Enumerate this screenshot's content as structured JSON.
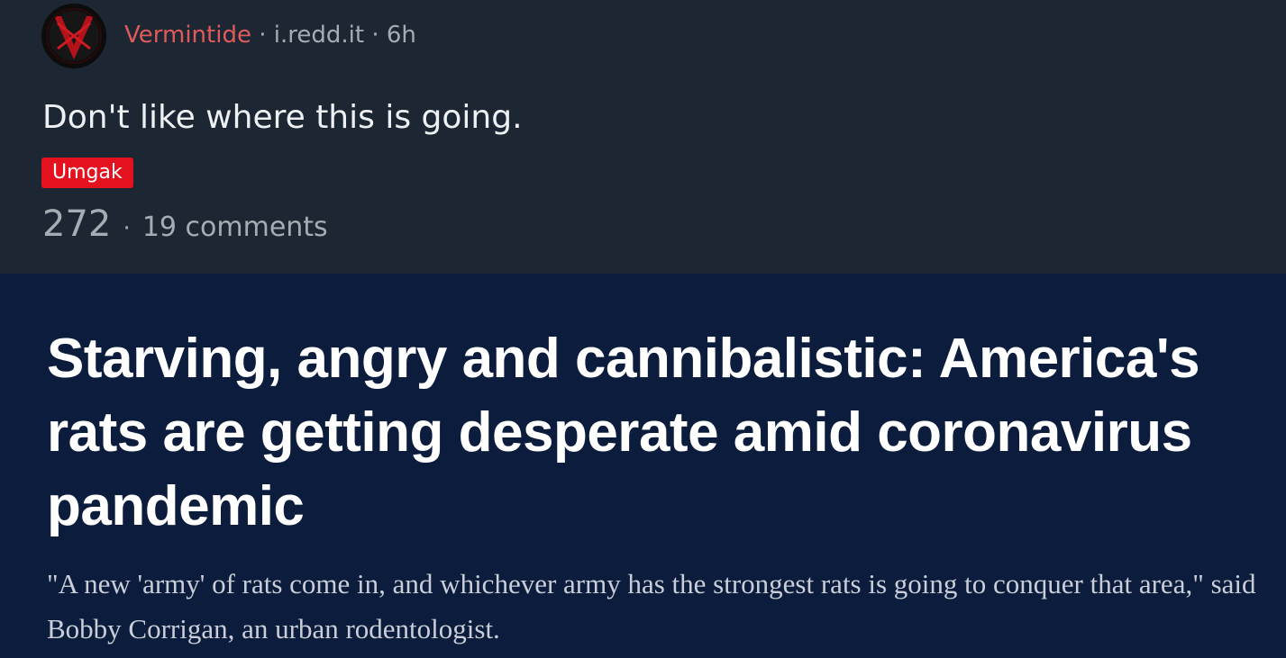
{
  "post": {
    "author": "Vermintide",
    "domain": "i.redd.it",
    "age": "6h",
    "separator": "·",
    "title": "Don't like where this is going.",
    "flair": "Umgak",
    "score": "272",
    "comments": "19 comments",
    "avatar_icon": "red-v-crossed-swords-icon",
    "colors": {
      "author": "#e05a5a",
      "flair_bg": "#e4111f",
      "card_bg": "#1d2733",
      "image_bg": "#0c1c3c"
    }
  },
  "image": {
    "headline": "Starving, angry and cannibalistic: America's rats are getting desperate amid coronavirus pandemic",
    "dek": "\"A new 'army' of rats come in, and whichever army has the strongest rats is going to conquer that area,\" said Bobby Corrigan, an urban rodentologist."
  }
}
